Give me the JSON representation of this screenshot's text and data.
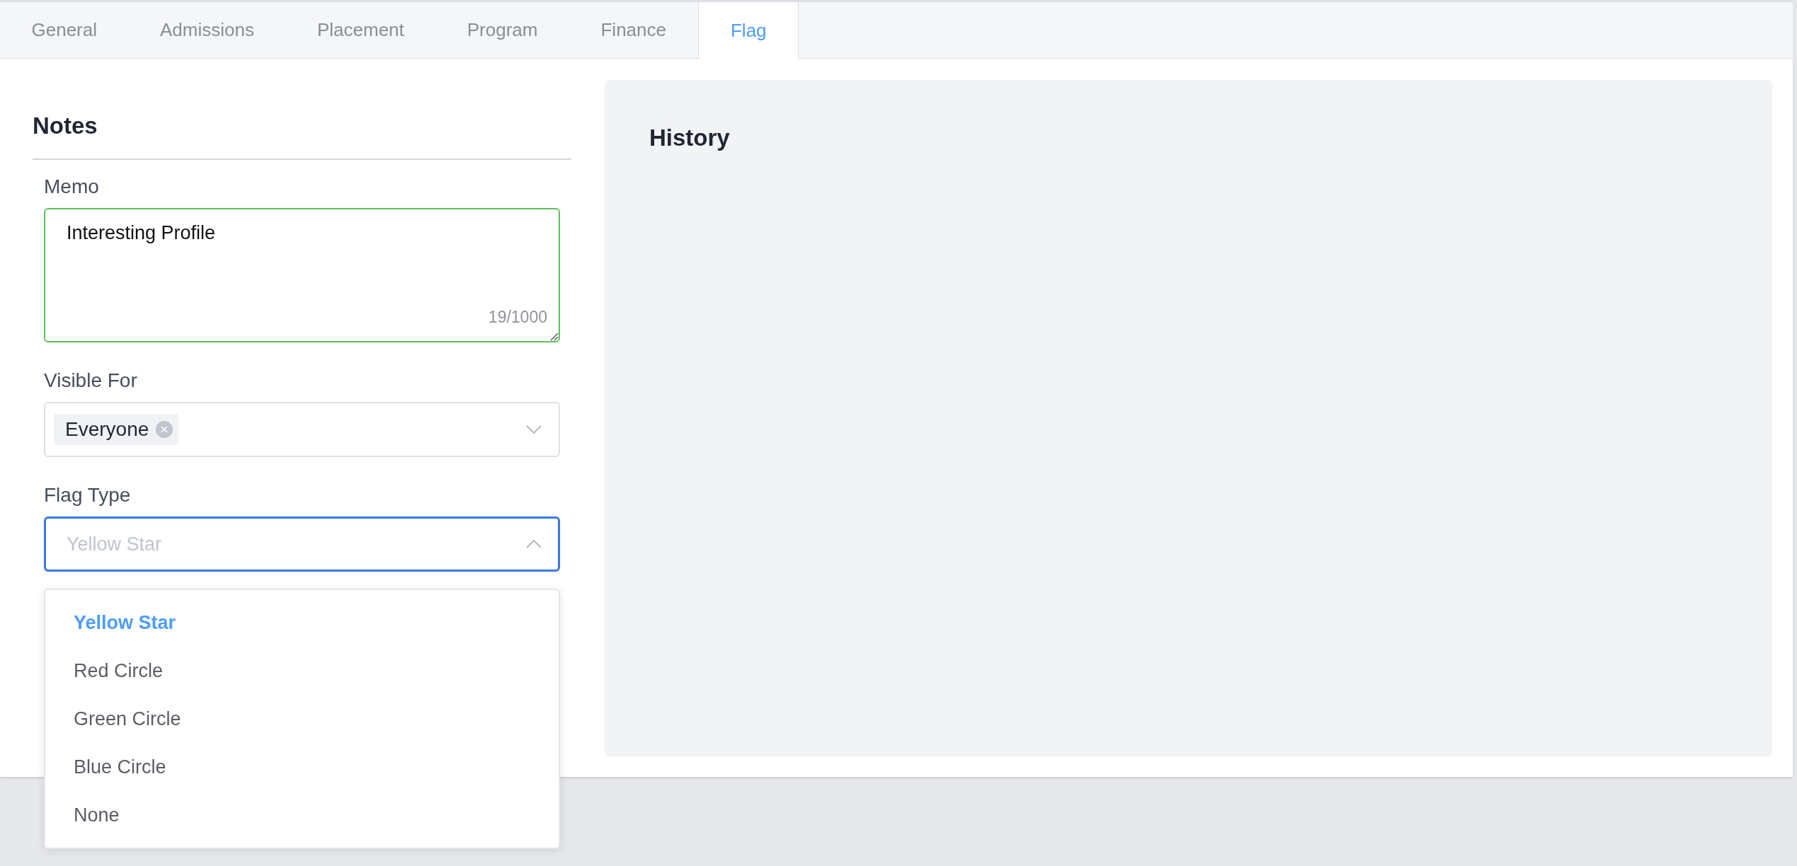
{
  "tabs": [
    {
      "label": "General",
      "selected": false
    },
    {
      "label": "Admissions",
      "selected": false
    },
    {
      "label": "Placement",
      "selected": false
    },
    {
      "label": "Program",
      "selected": false
    },
    {
      "label": "Finance",
      "selected": false
    },
    {
      "label": "Flag",
      "selected": true
    }
  ],
  "notes": {
    "title": "Notes",
    "memo": {
      "label": "Memo",
      "value": "Interesting Profile",
      "counter": "19/1000",
      "valid": true
    },
    "visible_for": {
      "label": "Visible For",
      "tags": [
        "Everyone"
      ],
      "expanded": false
    },
    "flag_type": {
      "label": "Flag Type",
      "placeholder": "Yellow Star",
      "expanded": true,
      "options": [
        {
          "label": "Yellow Star",
          "selected": true
        },
        {
          "label": "Red Circle",
          "selected": false
        },
        {
          "label": "Green Circle",
          "selected": false
        },
        {
          "label": "Blue Circle",
          "selected": false
        },
        {
          "label": "None",
          "selected": false
        }
      ]
    }
  },
  "history": {
    "title": "History"
  }
}
